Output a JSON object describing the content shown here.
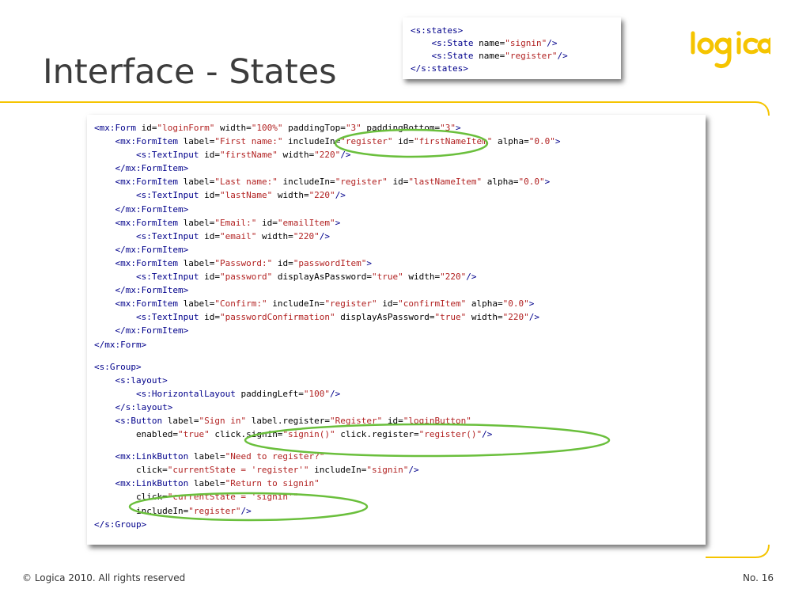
{
  "slide": {
    "title": "Interface - States",
    "footer_left": "© Logica 2010. All rights reserved",
    "footer_right": "No. 16"
  },
  "logo": {
    "text": "logica",
    "color": "#f5c400"
  },
  "colors": {
    "accent": "#f5c400",
    "highlight": "#6abf3c",
    "tag": "#00008b",
    "string": "#b22222"
  },
  "states_code": [
    [
      {
        "t": "<s:states>",
        "c": "tag"
      }
    ],
    [
      {
        "t": "    "
      },
      {
        "t": "<s:State",
        "c": "tag"
      },
      {
        "t": " name="
      },
      {
        "t": "\"signin\"",
        "c": "str"
      },
      {
        "t": "/>",
        "c": "tag"
      }
    ],
    [
      {
        "t": "    "
      },
      {
        "t": "<s:State",
        "c": "tag"
      },
      {
        "t": " name="
      },
      {
        "t": "\"register\"",
        "c": "str"
      },
      {
        "t": "/>",
        "c": "tag"
      }
    ],
    [
      {
        "t": "</s:states>",
        "c": "tag"
      }
    ]
  ],
  "main_code": [
    [
      {
        "t": "<mx:Form",
        "c": "tag"
      },
      {
        "t": " id="
      },
      {
        "t": "\"loginForm\"",
        "c": "str"
      },
      {
        "t": " width="
      },
      {
        "t": "\"100%\"",
        "c": "str"
      },
      {
        "t": " paddingTop="
      },
      {
        "t": "\"3\"",
        "c": "str"
      },
      {
        "t": " paddingBottom="
      },
      {
        "t": "\"3\"",
        "c": "str"
      },
      {
        "t": ">",
        "c": "tag"
      }
    ],
    [
      {
        "t": "    "
      },
      {
        "t": "<mx:FormItem",
        "c": "tag"
      },
      {
        "t": " label="
      },
      {
        "t": "\"First name:\"",
        "c": "str"
      },
      {
        "t": " includeIn="
      },
      {
        "t": "\"register\"",
        "c": "str"
      },
      {
        "t": " id="
      },
      {
        "t": "\"firstNameItem\"",
        "c": "str"
      },
      {
        "t": " alpha="
      },
      {
        "t": "\"0.0\"",
        "c": "str"
      },
      {
        "t": ">",
        "c": "tag"
      }
    ],
    [
      {
        "t": "        "
      },
      {
        "t": "<s:TextInput",
        "c": "tag"
      },
      {
        "t": " id="
      },
      {
        "t": "\"firstName\"",
        "c": "str"
      },
      {
        "t": " width="
      },
      {
        "t": "\"220\"",
        "c": "str"
      },
      {
        "t": "/>",
        "c": "tag"
      }
    ],
    [
      {
        "t": "    "
      },
      {
        "t": "</mx:FormItem>",
        "c": "tag"
      }
    ],
    [
      {
        "t": "    "
      },
      {
        "t": "<mx:FormItem",
        "c": "tag"
      },
      {
        "t": " label="
      },
      {
        "t": "\"Last name:\"",
        "c": "str"
      },
      {
        "t": " includeIn="
      },
      {
        "t": "\"register\"",
        "c": "str"
      },
      {
        "t": " id="
      },
      {
        "t": "\"lastNameItem\"",
        "c": "str"
      },
      {
        "t": " alpha="
      },
      {
        "t": "\"0.0\"",
        "c": "str"
      },
      {
        "t": ">",
        "c": "tag"
      }
    ],
    [
      {
        "t": "        "
      },
      {
        "t": "<s:TextInput",
        "c": "tag"
      },
      {
        "t": " id="
      },
      {
        "t": "\"lastName\"",
        "c": "str"
      },
      {
        "t": " width="
      },
      {
        "t": "\"220\"",
        "c": "str"
      },
      {
        "t": "/>",
        "c": "tag"
      }
    ],
    [
      {
        "t": "    "
      },
      {
        "t": "</mx:FormItem>",
        "c": "tag"
      }
    ],
    [
      {
        "t": "    "
      },
      {
        "t": "<mx:FormItem",
        "c": "tag"
      },
      {
        "t": " label="
      },
      {
        "t": "\"Email:\"",
        "c": "str"
      },
      {
        "t": " id="
      },
      {
        "t": "\"emailItem\"",
        "c": "str"
      },
      {
        "t": ">",
        "c": "tag"
      }
    ],
    [
      {
        "t": "        "
      },
      {
        "t": "<s:TextInput",
        "c": "tag"
      },
      {
        "t": " id="
      },
      {
        "t": "\"email\"",
        "c": "str"
      },
      {
        "t": " width="
      },
      {
        "t": "\"220\"",
        "c": "str"
      },
      {
        "t": "/>",
        "c": "tag"
      }
    ],
    [
      {
        "t": "    "
      },
      {
        "t": "</mx:FormItem>",
        "c": "tag"
      }
    ],
    [
      {
        "t": "    "
      },
      {
        "t": "<mx:FormItem",
        "c": "tag"
      },
      {
        "t": " label="
      },
      {
        "t": "\"Password:\"",
        "c": "str"
      },
      {
        "t": " id="
      },
      {
        "t": "\"passwordItem\"",
        "c": "str"
      },
      {
        "t": ">",
        "c": "tag"
      }
    ],
    [
      {
        "t": "        "
      },
      {
        "t": "<s:TextInput",
        "c": "tag"
      },
      {
        "t": " id="
      },
      {
        "t": "\"password\"",
        "c": "str"
      },
      {
        "t": " displayAsPassword="
      },
      {
        "t": "\"true\"",
        "c": "str"
      },
      {
        "t": " width="
      },
      {
        "t": "\"220\"",
        "c": "str"
      },
      {
        "t": "/>",
        "c": "tag"
      }
    ],
    [
      {
        "t": "    "
      },
      {
        "t": "</mx:FormItem>",
        "c": "tag"
      }
    ],
    [
      {
        "t": "    "
      },
      {
        "t": "<mx:FormItem",
        "c": "tag"
      },
      {
        "t": " label="
      },
      {
        "t": "\"Confirm:\"",
        "c": "str"
      },
      {
        "t": " includeIn="
      },
      {
        "t": "\"register\"",
        "c": "str"
      },
      {
        "t": " id="
      },
      {
        "t": "\"confirmItem\"",
        "c": "str"
      },
      {
        "t": " alpha="
      },
      {
        "t": "\"0.0\"",
        "c": "str"
      },
      {
        "t": ">",
        "c": "tag"
      }
    ],
    [
      {
        "t": "        "
      },
      {
        "t": "<s:TextInput",
        "c": "tag"
      },
      {
        "t": " id="
      },
      {
        "t": "\"passwordConfirmation\"",
        "c": "str"
      },
      {
        "t": " displayAsPassword="
      },
      {
        "t": "\"true\"",
        "c": "str"
      },
      {
        "t": " width="
      },
      {
        "t": "\"220\"",
        "c": "str"
      },
      {
        "t": "/>",
        "c": "tag"
      }
    ],
    [
      {
        "t": "    "
      },
      {
        "t": "</mx:FormItem>",
        "c": "tag"
      }
    ],
    [
      {
        "t": "</mx:Form>",
        "c": "tag"
      }
    ],
    [],
    [
      {
        "t": "<s:Group>",
        "c": "tag"
      }
    ],
    [
      {
        "t": "    "
      },
      {
        "t": "<s:layout>",
        "c": "tag"
      }
    ],
    [
      {
        "t": "        "
      },
      {
        "t": "<s:HorizontalLayout",
        "c": "tag"
      },
      {
        "t": " paddingLeft="
      },
      {
        "t": "\"100\"",
        "c": "str"
      },
      {
        "t": "/>",
        "c": "tag"
      }
    ],
    [
      {
        "t": "    "
      },
      {
        "t": "</s:layout>",
        "c": "tag"
      }
    ],
    [
      {
        "t": "    "
      },
      {
        "t": "<s:Button",
        "c": "tag"
      },
      {
        "t": " label="
      },
      {
        "t": "\"Sign in\"",
        "c": "str"
      },
      {
        "t": " label.register="
      },
      {
        "t": "\"Register\"",
        "c": "str"
      },
      {
        "t": " id="
      },
      {
        "t": "\"loginButton\"",
        "c": "str"
      }
    ],
    [
      {
        "t": "        enabled="
      },
      {
        "t": "\"true\"",
        "c": "str"
      },
      {
        "t": " click.signin="
      },
      {
        "t": "\"signin()\"",
        "c": "str"
      },
      {
        "t": " click.register="
      },
      {
        "t": "\"register()\"",
        "c": "str"
      },
      {
        "t": "/>",
        "c": "tag"
      }
    ],
    [],
    [
      {
        "t": "    "
      },
      {
        "t": "<mx:LinkButton",
        "c": "tag"
      },
      {
        "t": " label="
      },
      {
        "t": "\"Need to register?\"",
        "c": "str"
      }
    ],
    [
      {
        "t": "        click="
      },
      {
        "t": "\"currentState = 'register'\"",
        "c": "str"
      },
      {
        "t": " includeIn="
      },
      {
        "t": "\"signin\"",
        "c": "str"
      },
      {
        "t": "/>",
        "c": "tag"
      }
    ],
    [
      {
        "t": "    "
      },
      {
        "t": "<mx:LinkButton",
        "c": "tag"
      },
      {
        "t": " label="
      },
      {
        "t": "\"Return to signin\"",
        "c": "str"
      }
    ],
    [
      {
        "t": "        click="
      },
      {
        "t": "\"currentState = 'signin'\"",
        "c": "str"
      }
    ],
    [
      {
        "t": "        includeIn="
      },
      {
        "t": "\"register\"",
        "c": "str"
      },
      {
        "t": "/>",
        "c": "tag"
      }
    ],
    [
      {
        "t": "</s:Group>",
        "c": "tag"
      }
    ]
  ]
}
